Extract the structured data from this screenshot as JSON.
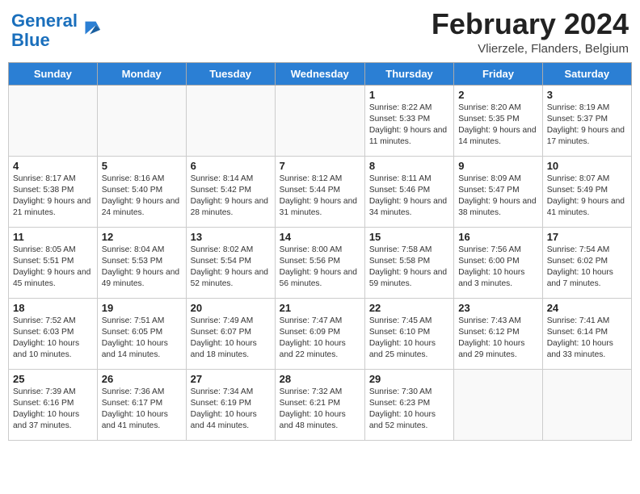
{
  "logo": {
    "line1": "General",
    "line2": "Blue"
  },
  "title": "February 2024",
  "location": "Vlierzele, Flanders, Belgium",
  "days_of_week": [
    "Sunday",
    "Monday",
    "Tuesday",
    "Wednesday",
    "Thursday",
    "Friday",
    "Saturday"
  ],
  "weeks": [
    [
      {
        "day": "",
        "info": ""
      },
      {
        "day": "",
        "info": ""
      },
      {
        "day": "",
        "info": ""
      },
      {
        "day": "",
        "info": ""
      },
      {
        "day": "1",
        "info": "Sunrise: 8:22 AM\nSunset: 5:33 PM\nDaylight: 9 hours and 11 minutes."
      },
      {
        "day": "2",
        "info": "Sunrise: 8:20 AM\nSunset: 5:35 PM\nDaylight: 9 hours and 14 minutes."
      },
      {
        "day": "3",
        "info": "Sunrise: 8:19 AM\nSunset: 5:37 PM\nDaylight: 9 hours and 17 minutes."
      }
    ],
    [
      {
        "day": "4",
        "info": "Sunrise: 8:17 AM\nSunset: 5:38 PM\nDaylight: 9 hours and 21 minutes."
      },
      {
        "day": "5",
        "info": "Sunrise: 8:16 AM\nSunset: 5:40 PM\nDaylight: 9 hours and 24 minutes."
      },
      {
        "day": "6",
        "info": "Sunrise: 8:14 AM\nSunset: 5:42 PM\nDaylight: 9 hours and 28 minutes."
      },
      {
        "day": "7",
        "info": "Sunrise: 8:12 AM\nSunset: 5:44 PM\nDaylight: 9 hours and 31 minutes."
      },
      {
        "day": "8",
        "info": "Sunrise: 8:11 AM\nSunset: 5:46 PM\nDaylight: 9 hours and 34 minutes."
      },
      {
        "day": "9",
        "info": "Sunrise: 8:09 AM\nSunset: 5:47 PM\nDaylight: 9 hours and 38 minutes."
      },
      {
        "day": "10",
        "info": "Sunrise: 8:07 AM\nSunset: 5:49 PM\nDaylight: 9 hours and 41 minutes."
      }
    ],
    [
      {
        "day": "11",
        "info": "Sunrise: 8:05 AM\nSunset: 5:51 PM\nDaylight: 9 hours and 45 minutes."
      },
      {
        "day": "12",
        "info": "Sunrise: 8:04 AM\nSunset: 5:53 PM\nDaylight: 9 hours and 49 minutes."
      },
      {
        "day": "13",
        "info": "Sunrise: 8:02 AM\nSunset: 5:54 PM\nDaylight: 9 hours and 52 minutes."
      },
      {
        "day": "14",
        "info": "Sunrise: 8:00 AM\nSunset: 5:56 PM\nDaylight: 9 hours and 56 minutes."
      },
      {
        "day": "15",
        "info": "Sunrise: 7:58 AM\nSunset: 5:58 PM\nDaylight: 9 hours and 59 minutes."
      },
      {
        "day": "16",
        "info": "Sunrise: 7:56 AM\nSunset: 6:00 PM\nDaylight: 10 hours and 3 minutes."
      },
      {
        "day": "17",
        "info": "Sunrise: 7:54 AM\nSunset: 6:02 PM\nDaylight: 10 hours and 7 minutes."
      }
    ],
    [
      {
        "day": "18",
        "info": "Sunrise: 7:52 AM\nSunset: 6:03 PM\nDaylight: 10 hours and 10 minutes."
      },
      {
        "day": "19",
        "info": "Sunrise: 7:51 AM\nSunset: 6:05 PM\nDaylight: 10 hours and 14 minutes."
      },
      {
        "day": "20",
        "info": "Sunrise: 7:49 AM\nSunset: 6:07 PM\nDaylight: 10 hours and 18 minutes."
      },
      {
        "day": "21",
        "info": "Sunrise: 7:47 AM\nSunset: 6:09 PM\nDaylight: 10 hours and 22 minutes."
      },
      {
        "day": "22",
        "info": "Sunrise: 7:45 AM\nSunset: 6:10 PM\nDaylight: 10 hours and 25 minutes."
      },
      {
        "day": "23",
        "info": "Sunrise: 7:43 AM\nSunset: 6:12 PM\nDaylight: 10 hours and 29 minutes."
      },
      {
        "day": "24",
        "info": "Sunrise: 7:41 AM\nSunset: 6:14 PM\nDaylight: 10 hours and 33 minutes."
      }
    ],
    [
      {
        "day": "25",
        "info": "Sunrise: 7:39 AM\nSunset: 6:16 PM\nDaylight: 10 hours and 37 minutes."
      },
      {
        "day": "26",
        "info": "Sunrise: 7:36 AM\nSunset: 6:17 PM\nDaylight: 10 hours and 41 minutes."
      },
      {
        "day": "27",
        "info": "Sunrise: 7:34 AM\nSunset: 6:19 PM\nDaylight: 10 hours and 44 minutes."
      },
      {
        "day": "28",
        "info": "Sunrise: 7:32 AM\nSunset: 6:21 PM\nDaylight: 10 hours and 48 minutes."
      },
      {
        "day": "29",
        "info": "Sunrise: 7:30 AM\nSunset: 6:23 PM\nDaylight: 10 hours and 52 minutes."
      },
      {
        "day": "",
        "info": ""
      },
      {
        "day": "",
        "info": ""
      }
    ]
  ]
}
